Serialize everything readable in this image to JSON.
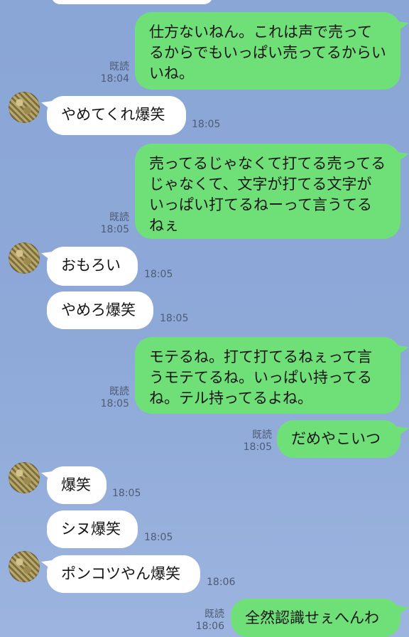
{
  "messages": [
    {
      "id": "m1",
      "from": "me",
      "text": "仕方ないねん。これは声で売ってるからでもいっぱい売ってるからいいね。",
      "read": "既読",
      "time": "18:04"
    },
    {
      "id": "m2",
      "from": "them",
      "text": "やめてくれ爆笑",
      "time": "18:05"
    },
    {
      "id": "m3",
      "from": "me",
      "text": "売ってるじゃなくて打てる売ってるじゃなくて、文字が打てる文字がいっぱい打てるねーって言うてるねぇ",
      "read": "既読",
      "time": "18:05"
    },
    {
      "id": "m4",
      "from": "them",
      "text": "おもろい",
      "time": "18:05"
    },
    {
      "id": "m5",
      "from": "them",
      "text": "やめろ爆笑",
      "time": "18:05"
    },
    {
      "id": "m6",
      "from": "me",
      "text": "モテるね。打て打てるねぇって言うモテてるね。いっぱい持ってるね。テル持ってるよね。",
      "read": "既読",
      "time": "18:05"
    },
    {
      "id": "m7",
      "from": "me",
      "text": "だめやこいつ",
      "read": "既読",
      "time": "18:05"
    },
    {
      "id": "m8",
      "from": "them",
      "text": "爆笑",
      "time": "18:05"
    },
    {
      "id": "m9",
      "from": "them",
      "text": "シヌ爆笑",
      "time": "18:05"
    },
    {
      "id": "m10",
      "from": "them",
      "text": "ポンコツやん爆笑",
      "time": "18:06"
    },
    {
      "id": "m11",
      "from": "me",
      "text": "全然認識せぇへんわ",
      "read": "既読",
      "time": "18:06"
    }
  ],
  "colors": {
    "background": "#8aa6d6",
    "outgoing": "#6fe078",
    "incoming": "#ffffff"
  },
  "icons": {
    "avatar": "contact-avatar"
  }
}
